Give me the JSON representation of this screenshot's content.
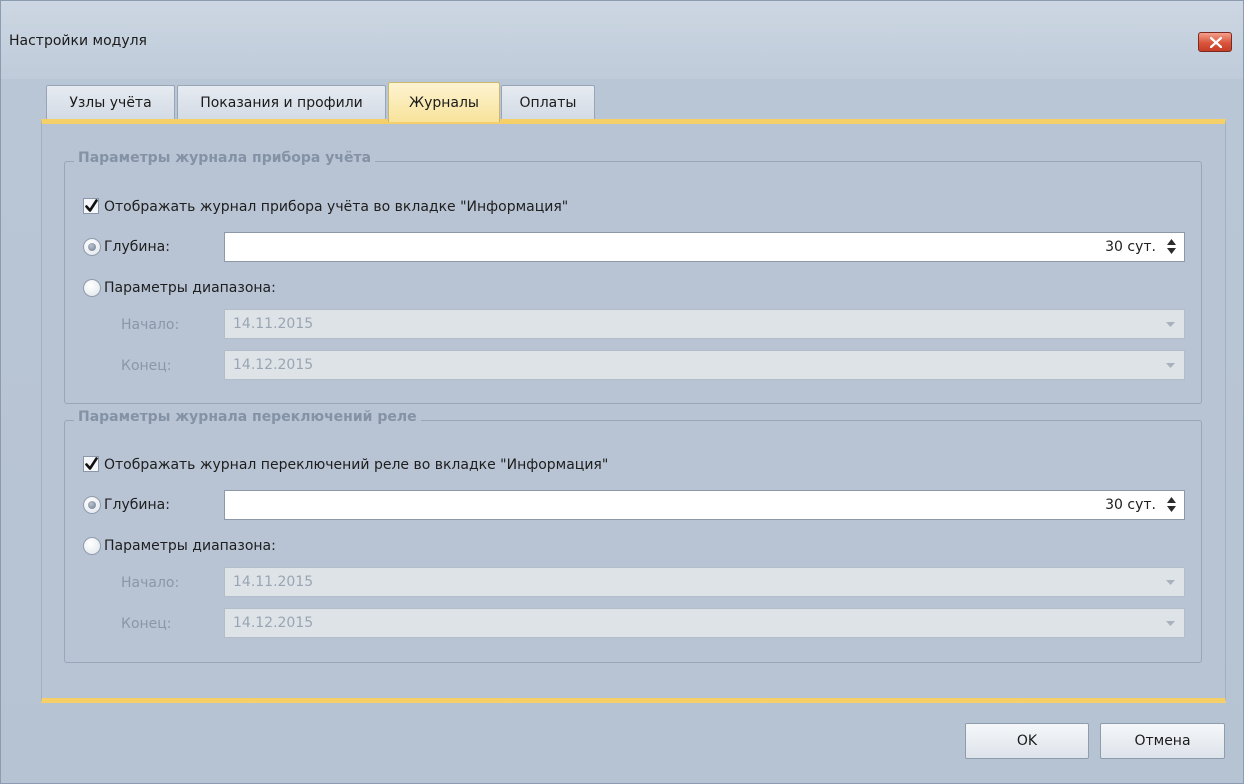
{
  "window": {
    "title": "Настройки модуля"
  },
  "tabs": [
    {
      "label": "Узлы учёта"
    },
    {
      "label": "Показания и профили"
    },
    {
      "label": "Журналы",
      "active": true
    },
    {
      "label": "Оплаты"
    }
  ],
  "groups": [
    {
      "title": "Параметры журнала прибора учёта",
      "show_checkbox": {
        "label": "Отображать журнал прибора учёта во вкладке \"Информация\"",
        "checked": true
      },
      "depth": {
        "label": "Глубина:",
        "selected": true,
        "value": "30 сут."
      },
      "range": {
        "label": "Параметры диапазона:",
        "selected": false,
        "start_label": "Начало:",
        "start_value": "14.11.2015",
        "end_label": "Конец:",
        "end_value": "14.12.2015"
      }
    },
    {
      "title": "Параметры журнала переключений реле",
      "show_checkbox": {
        "label": "Отображать журнал переключений реле во вкладке \"Информация\"",
        "checked": true
      },
      "depth": {
        "label": "Глубина:",
        "selected": true,
        "value": "30 сут."
      },
      "range": {
        "label": "Параметры диапазона:",
        "selected": false,
        "start_label": "Начало:",
        "start_value": "14.11.2015",
        "end_label": "Конец:",
        "end_value": "14.12.2015"
      }
    }
  ],
  "buttons": {
    "ok": "OK",
    "cancel": "Отмена"
  },
  "colors": {
    "accent_yellow": "#f5cf67",
    "panel_bg": "#b8c4d4",
    "title_close_red": "#d9553c"
  }
}
